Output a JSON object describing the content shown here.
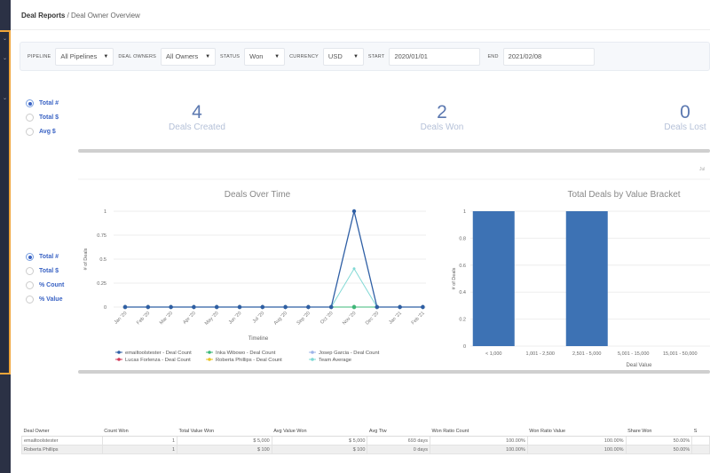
{
  "breadcrumb": {
    "root": "Deal Reports",
    "separator": " / ",
    "current": "Deal Owner Overview"
  },
  "filters": {
    "pipeline_label": "PIPELINE",
    "pipeline": "All Pipelines",
    "owners_label": "DEAL OWNERS",
    "owners": "All Owners",
    "status_label": "STATUS",
    "status": "Won",
    "currency_label": "CURRENCY",
    "currency": "USD",
    "start_label": "START",
    "start": "2020/01/01",
    "end_label": "END",
    "end": "2021/02/08"
  },
  "stat_mode": {
    "options": [
      "Total #",
      "Total $",
      "Avg $"
    ],
    "selected": 0
  },
  "chart_mode": {
    "options": [
      "Total #",
      "Total $",
      "% Count",
      "% Value"
    ],
    "selected": 0
  },
  "stats": [
    {
      "value": "4",
      "label": "Deals Created"
    },
    {
      "value": "2",
      "label": "Deals Won"
    },
    {
      "value": "0",
      "label": "Deals Lost"
    }
  ],
  "cut_label": "Jul",
  "colors": {
    "accent": "#3a63c4",
    "bar": "#3d72b4",
    "sidebar": "#2b3145",
    "highlight": "#f0a53a"
  },
  "chart_data": [
    {
      "type": "line",
      "title": "Deals Over Time",
      "xlabel": "Timeline",
      "ylabel": "# of Deals",
      "ylim": [
        0,
        1
      ],
      "yticks": [
        "0",
        "0.25",
        "0.5",
        "0.75",
        "1"
      ],
      "grid": true,
      "legend": "bottom",
      "categories": [
        "Jan '20",
        "Feb '20",
        "Mar '20",
        "Apr '20",
        "May '20",
        "Jun '20",
        "Jul '20",
        "Aug '20",
        "Sep '20",
        "Oct '20",
        "Nov '20",
        "Dec '20",
        "Jan '21",
        "Feb '21"
      ],
      "series": [
        {
          "name": "emailtoolstester - Deal Count",
          "color": "#2f5fa5",
          "values": [
            0,
            0,
            0,
            0,
            0,
            0,
            0,
            0,
            0,
            0,
            1,
            0,
            0,
            0
          ]
        },
        {
          "name": "Inka Wibowo - Deal Count",
          "color": "#3cb878",
          "values": [
            0,
            0,
            0,
            0,
            0,
            0,
            0,
            0,
            0,
            0,
            0,
            0,
            0,
            0
          ]
        },
        {
          "name": "Josep Garcia - Deal Count",
          "color": "#9db4e8",
          "values": [
            0,
            0,
            0,
            0,
            0,
            0,
            0,
            0,
            0,
            0,
            0,
            0,
            0,
            0
          ]
        },
        {
          "name": "Lucas Forlenza - Deal Count",
          "color": "#d23c5a",
          "values": [
            0,
            0,
            0,
            0,
            0,
            0,
            0,
            0,
            0,
            0,
            0,
            0,
            0,
            0
          ]
        },
        {
          "name": "Roberta Phillips - Deal Count",
          "color": "#e8c42a",
          "values": [
            0,
            0,
            0,
            0,
            0,
            0,
            0,
            0,
            0,
            0,
            0,
            0,
            0,
            0
          ]
        },
        {
          "name": "Team Average",
          "color": "#7fd8d4",
          "values": [
            0,
            0,
            0,
            0,
            0,
            0,
            0,
            0,
            0,
            0,
            0.4,
            0,
            0,
            0
          ]
        }
      ]
    },
    {
      "type": "bar",
      "title": "Total Deals by Value Bracket",
      "xlabel": "Deal Value",
      "ylabel": "# of Deals",
      "ylim": [
        0,
        1
      ],
      "yticks": [
        "0",
        "0.2",
        "0.4",
        "0.6",
        "0.8",
        "1"
      ],
      "grid": true,
      "categories": [
        "< 1,000",
        "1,001 - 2,500",
        "2,501 - 5,000",
        "5,001 - 15,000",
        "15,001 - 50,000"
      ],
      "values": [
        1,
        0,
        1,
        0,
        0
      ]
    }
  ],
  "table": {
    "headers": [
      "Deal Owner",
      "Count Won",
      "Total Value Won",
      "Avg Value Won",
      "Avg Ttw",
      "Won Ratio Count",
      "Won Ratio Value",
      "Share Won",
      "S"
    ],
    "rows": [
      [
        "emailtoolstester",
        "1",
        "$ 5,000",
        "$ 5,000",
        "693 days",
        "100.00%",
        "100.00%",
        "50.00%",
        ""
      ],
      [
        "Roberta Phillips",
        "1",
        "$ 100",
        "$ 100",
        "0 days",
        "100.00%",
        "100.00%",
        "50.00%",
        ""
      ]
    ]
  }
}
